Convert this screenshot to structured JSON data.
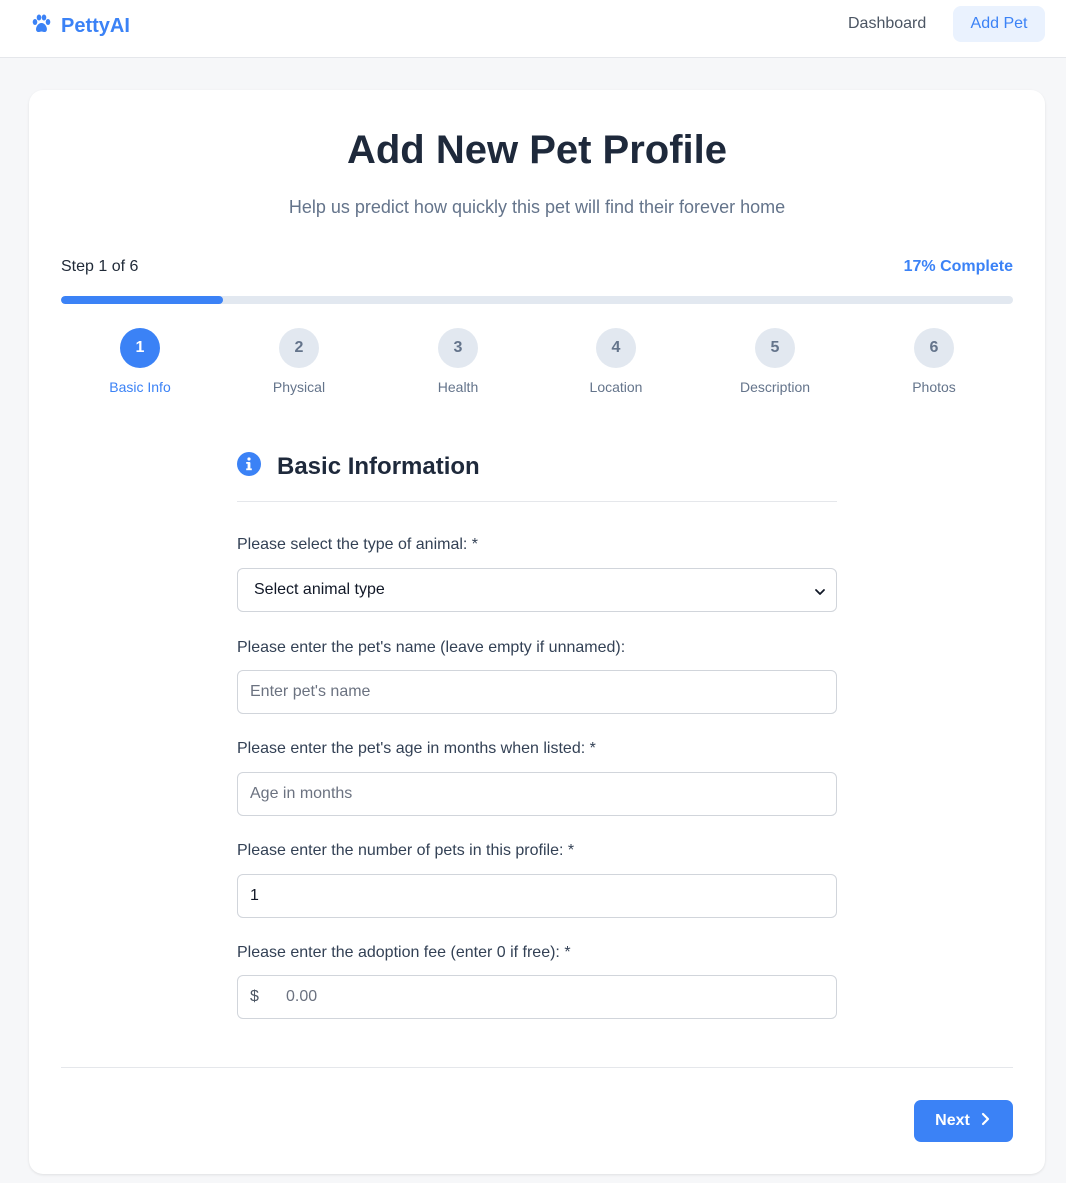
{
  "header": {
    "brand": "PettyAI",
    "nav": [
      {
        "label": "Dashboard"
      },
      {
        "label": "Add Pet",
        "active": true
      }
    ]
  },
  "page": {
    "title": "Add New Pet Profile",
    "subtitle": "Help us predict how quickly this pet will find their forever home"
  },
  "progress": {
    "step_text": "Step 1 of 6",
    "complete_text": "17% Complete",
    "percent": 17
  },
  "steps": [
    {
      "number": "1",
      "label": "Basic Info",
      "active": true
    },
    {
      "number": "2",
      "label": "Physical"
    },
    {
      "number": "3",
      "label": "Health"
    },
    {
      "number": "4",
      "label": "Location"
    },
    {
      "number": "5",
      "label": "Description"
    },
    {
      "number": "6",
      "label": "Photos"
    }
  ],
  "section": {
    "title": "Basic Information",
    "icon": "info-icon"
  },
  "form": {
    "animal_type": {
      "label": "Please select the type of animal: *",
      "value": "Select animal type"
    },
    "pet_name": {
      "label": "Please enter the pet's name (leave empty if unnamed):",
      "placeholder": "Enter pet's name",
      "value": ""
    },
    "age": {
      "label": "Please enter the pet's age in months when listed: *",
      "placeholder": "Age in months",
      "value": ""
    },
    "quantity": {
      "label": "Please enter the number of pets in this profile: *",
      "value": "1"
    },
    "fee": {
      "label": "Please enter the adoption fee (enter 0 if free): *",
      "prefix": "$",
      "placeholder": "0.00",
      "value": ""
    }
  },
  "actions": {
    "next_label": "Next"
  },
  "colors": {
    "accent": "#3b82f6",
    "accent_soft": "#eaf2fe",
    "muted": "#64748b",
    "track": "#e2e8f0"
  }
}
